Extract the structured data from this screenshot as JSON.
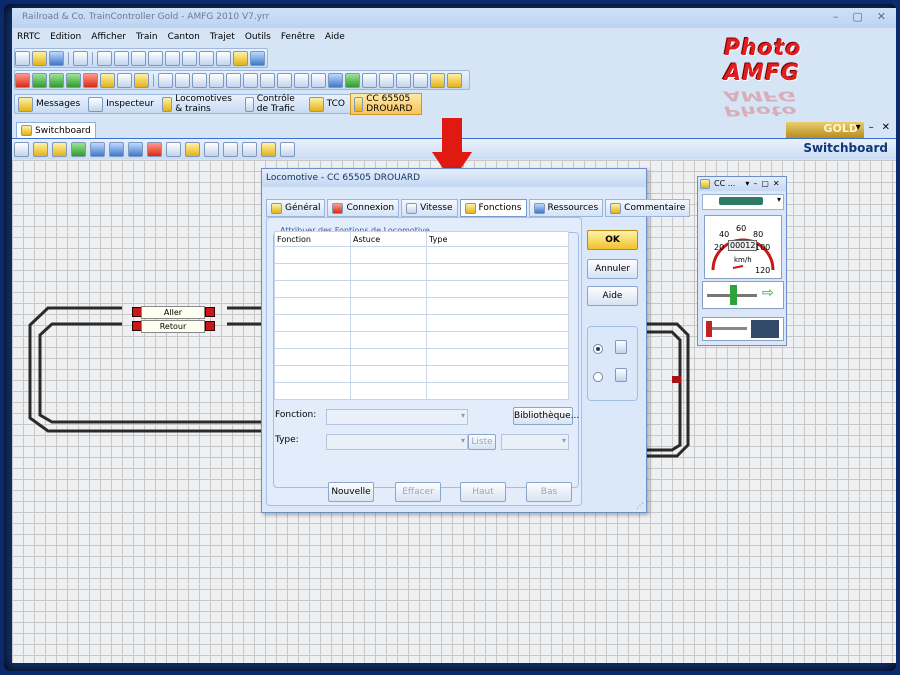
{
  "window": {
    "title": "Railroad & Co. TrainController Gold - AMFG 2010 V7.yrr"
  },
  "menu": [
    "RRTC",
    "Edition",
    "Afficher",
    "Train",
    "Canton",
    "Trajet",
    "Outils",
    "Fenêtre",
    "Aide"
  ],
  "toolbar3": [
    {
      "label": "Messages",
      "icon": "messages-icon"
    },
    {
      "label": "Inspecteur",
      "icon": "inspector-icon"
    },
    {
      "label": "Locomotives & trains",
      "icon": "locomotive-icon"
    },
    {
      "label": "Contrôle de Trafic",
      "icon": "traffic-control-icon"
    },
    {
      "label": "TCO",
      "icon": "tco-icon"
    },
    {
      "label": "CC 65505 DROUARD",
      "icon": "locomotive-icon"
    }
  ],
  "logo": {
    "text": "Photo AMFG"
  },
  "document_tab": {
    "label": "Switchboard"
  },
  "gold_badge": "GOLD",
  "switchboard_label": "Switchboard",
  "blocks": {
    "aller": "Aller",
    "retour": "Retour"
  },
  "dialog": {
    "title": "Locomotive - CC 65505 DROUARD",
    "tabs": [
      {
        "label": "Général",
        "icon": "general-icon"
      },
      {
        "label": "Connexion",
        "icon": "connection-icon"
      },
      {
        "label": "Vitesse",
        "icon": "speed-icon"
      },
      {
        "label": "Fonctions",
        "icon": "functions-icon",
        "selected": true
      },
      {
        "label": "Ressources",
        "icon": "resources-icon"
      },
      {
        "label": "Commentaire",
        "icon": "comment-icon"
      }
    ],
    "group_label": "Attribuer des Fontions de Locomotive",
    "table": {
      "headers": [
        "Fonction",
        "Astuce",
        "Type"
      ],
      "rows": 9
    },
    "fonction_label": "Fonction:",
    "type_label": "Type:",
    "bibliotheque": "Bibliothèque...",
    "liste": "Liste",
    "buttons": {
      "nouvelle": "Nouvelle",
      "effacer": "Effacer",
      "haut": "Haut",
      "bas": "Bas"
    },
    "ok": "OK",
    "annuler": "Annuler",
    "aide": "Aide"
  },
  "loco_window": {
    "title": "CC ...",
    "speed_readout": "00012",
    "unit": "km/h",
    "ticks": [
      "20",
      "40",
      "60",
      "80",
      "100",
      "120"
    ]
  }
}
